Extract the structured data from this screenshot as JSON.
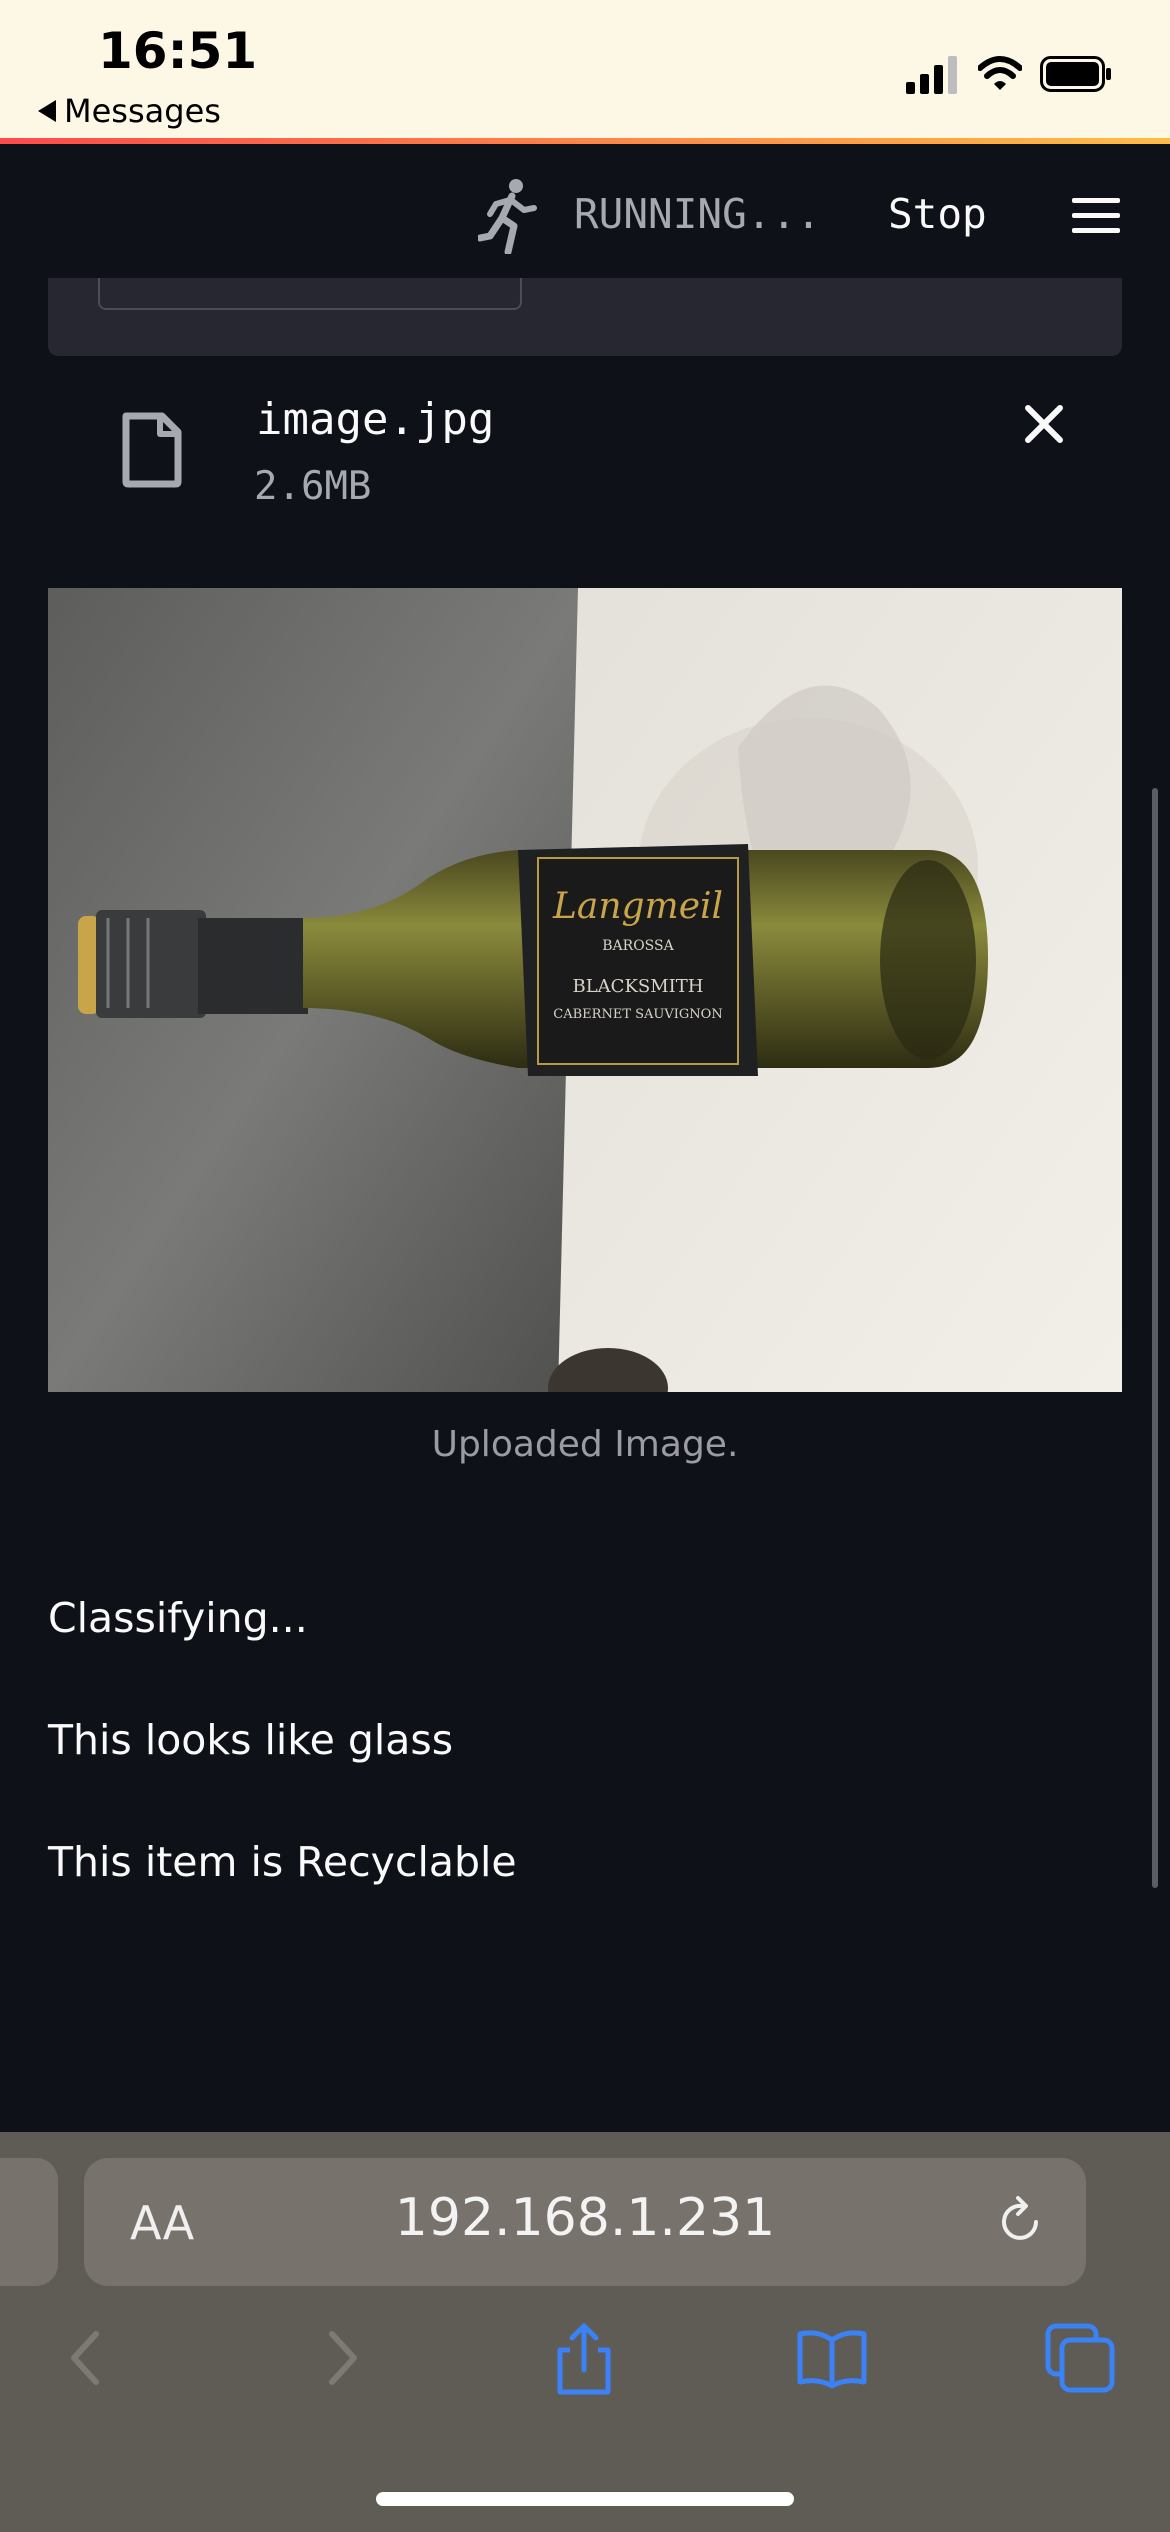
{
  "status_bar": {
    "time": "16:51",
    "back_app": "Messages"
  },
  "header": {
    "status_text": "RUNNING...",
    "stop_label": "Stop"
  },
  "file": {
    "name": "image.jpg",
    "size": "2.6MB"
  },
  "image": {
    "caption": "Uploaded Image.",
    "label_text": [
      "Langmeil",
      "BAROSSA",
      "BLACKSMITH",
      "CABERNET SAUVIGNON"
    ]
  },
  "results": {
    "line1": "Classifying...",
    "line2": "This looks like glass",
    "line3": "This item is Recyclable"
  },
  "browser": {
    "text_size_label": "AA",
    "url": "192.168.1.231"
  },
  "colors": {
    "app_bg": "#0e1117",
    "accent_red": "#ff4b4b",
    "safari_tint": "#3b82f6"
  }
}
